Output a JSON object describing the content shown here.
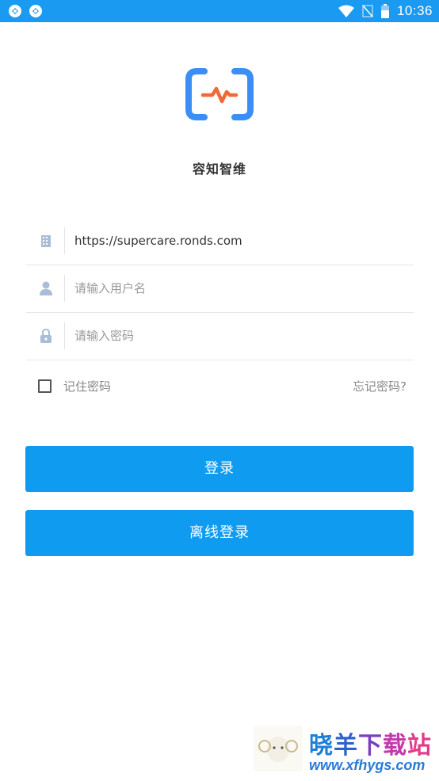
{
  "status_bar": {
    "time": "10:36",
    "icons": [
      "sync-icon",
      "sync-icon",
      "wifi-icon",
      "no-signal-icon",
      "battery-icon"
    ]
  },
  "app": {
    "name": "容知智维",
    "logo": "heartbeat-bracket-logo"
  },
  "form": {
    "server": {
      "value": "https://supercare.ronds.com",
      "icon": "building-icon"
    },
    "username": {
      "placeholder": "请输入用户名",
      "value": "",
      "icon": "user-icon"
    },
    "password": {
      "placeholder": "请输入密码",
      "value": "",
      "icon": "lock-icon"
    },
    "remember": {
      "label": "记住密码",
      "checked": false
    },
    "forgot_label": "忘记密码?"
  },
  "buttons": {
    "login": "登录",
    "offline_login": "离线登录"
  },
  "colors": {
    "primary": "#0f9bef",
    "status_bar": "#1a9af0",
    "logo_blue": "#3a8ef6",
    "logo_orange": "#ef6a3a"
  },
  "watermark": {
    "title": [
      "晓",
      "羊",
      "下",
      "载",
      "站"
    ],
    "url": "www.xfhygs.com"
  }
}
